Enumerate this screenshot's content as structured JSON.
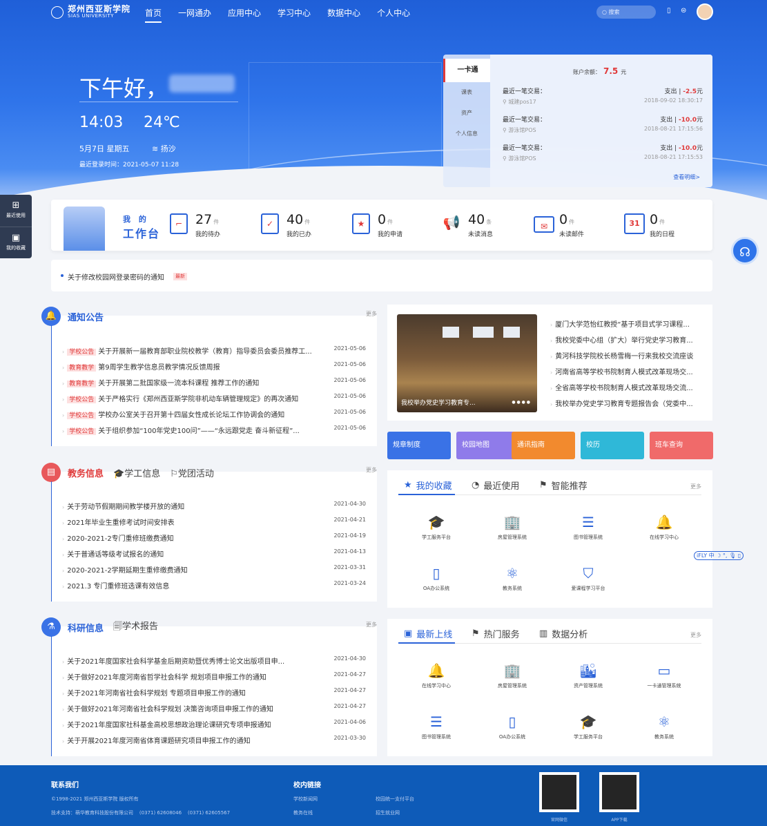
{
  "nav": {
    "logo_cn": "郑州西亚斯学院",
    "logo_en": "SIAS UNIVERSITY",
    "menu": [
      "首页",
      "一网通办",
      "应用中心",
      "学习中心",
      "数据中心",
      "个人中心"
    ],
    "search_placeholder": "搜索"
  },
  "hero": {
    "greeting": "下午好，",
    "time": "14:03",
    "temperature": "24℃",
    "date": "5月7日 星期五",
    "weather": "扬沙",
    "last_login": "最近登录时间：2021-05-07 11:28"
  },
  "card": {
    "tabs": [
      "一卡通",
      "课表",
      "资产",
      "个人信息"
    ],
    "balance_label": "账户余额：",
    "balance": "7.5",
    "balance_unit": "元",
    "transactions": [
      {
        "label": "最近一笔交易：",
        "place": "城建pos17",
        "type": "支出 | ",
        "amount": "-2.5",
        "unit": "元",
        "time": "2018-09-02 18:30:17"
      },
      {
        "label": "最近一笔交易：",
        "place": "游泳馆POS",
        "type": "支出 | ",
        "amount": "-10.0",
        "unit": "元",
        "time": "2018-08-21 17:15:56"
      },
      {
        "label": "最近一笔交易：",
        "place": "游泳馆POS",
        "type": "支出 | ",
        "amount": "-10.0",
        "unit": "元",
        "time": "2018-08-21 17:15:53"
      }
    ],
    "more": "查看明细>"
  },
  "side": {
    "recent": "最近使用",
    "fav": "我的收藏"
  },
  "workbench": {
    "title1": "我 的",
    "title2": "工作台",
    "stats": [
      {
        "num": "27",
        "unit": "件",
        "label": "我的待办"
      },
      {
        "num": "40",
        "unit": "件",
        "label": "我的已办"
      },
      {
        "num": "0",
        "unit": "件",
        "label": "我的申请"
      },
      {
        "num": "40",
        "unit": "条",
        "label": "未读消息"
      },
      {
        "num": "0",
        "unit": "件",
        "label": "未读邮件"
      },
      {
        "num": "0",
        "unit": "件",
        "label": "我的日程"
      }
    ],
    "calendar_day": "31"
  },
  "notice": {
    "text": "关于修改校园网登录密码的通知",
    "badge": "最新"
  },
  "announcements": {
    "title": "通知公告",
    "more": "更多",
    "items": [
      {
        "tag": "学校公告",
        "title": "关于开展新一届教育部职业院校教学（教育）指导委员会委员推荐工...",
        "date": "2021-05-06"
      },
      {
        "tag": "教育教学",
        "title": "第9周学生教学信息员教学情况反馈周报",
        "date": "2021-05-06"
      },
      {
        "tag": "教育教学",
        "title": "关于开展第二批国家级一流本科课程 推荐工作的通知",
        "date": "2021-05-06"
      },
      {
        "tag": "学校公告",
        "title": "关于严格实行《郑州西亚斯学院非机动车辆管理规定》的再次通知",
        "date": "2021-05-06"
      },
      {
        "tag": "学校公告",
        "title": "学校办公室关于召开第十四届女性成长论坛工作协调会的通知",
        "date": "2021-05-06"
      },
      {
        "tag": "学校公告",
        "title": "关于组织参加“100年党史100问”——“永远跟党走 奋斗新征程”...",
        "date": "2021-05-06"
      }
    ]
  },
  "academic": {
    "title": "教务信息",
    "tab2": "学工信息",
    "tab3": "党团活动",
    "more": "更多",
    "items": [
      {
        "title": "关于劳动节假期期间教学楼开放的通知",
        "date": "2021-04-30"
      },
      {
        "title": "2021年毕业生重修考试时间安排表",
        "date": "2021-04-21"
      },
      {
        "title": "2020-2021-2专门重修班缴费通知",
        "date": "2021-04-19"
      },
      {
        "title": "关于普通话等级考试报名的通知",
        "date": "2021-04-13"
      },
      {
        "title": "2020-2021-2学期延期生重修缴费通知",
        "date": "2021-03-31"
      },
      {
        "title": "2021.3 专门重修班选课有效信息",
        "date": "2021-03-24"
      }
    ]
  },
  "research": {
    "title": "科研信息",
    "tab2": "学术报告",
    "more": "更多",
    "items": [
      {
        "title": "关于2021年度国家社会科学基金后期资助暨优秀博士论文出版项目申...",
        "date": "2021-04-30"
      },
      {
        "title": "关于做好2021年度河南省哲学社会科学 规划项目申报工作的通知",
        "date": "2021-04-27"
      },
      {
        "title": "关于2021年河南省社会科学规划 专题项目申报工作的通知",
        "date": "2021-04-27"
      },
      {
        "title": "关于做好2021年河南省社会科学规划 决策咨询项目申报工作的通知",
        "date": "2021-04-27"
      },
      {
        "title": "关于2021年度国家社科基金高校思想政治理论课研究专项申报通知",
        "date": "2021-04-06"
      },
      {
        "title": "关于开展2021年度河南省体育课题研究项目申报工作的通知",
        "date": "2021-03-30"
      }
    ]
  },
  "news": {
    "caption": "我校举办党史学习教育专...",
    "items": [
      "厦门大学范怡红教授“基于项目式学习课程...",
      "我校党委中心组（扩大）举行党史学习教育...",
      "黄河科技学院校长杨雪梅一行来我校交流座谈",
      "河南省高等学校书院制育人模式改革现场交...",
      "全省高等学校书院制育人模式改革现场交流...",
      "我校举办党史学习教育专题报告会（党委中..."
    ]
  },
  "quick": [
    {
      "label": "规章制度",
      "color": "#3a72e6"
    },
    {
      "label": "校园地图",
      "color": "#8f7bea"
    },
    {
      "label": "通讯指南",
      "color": "#f28a2e"
    },
    {
      "label": "校历",
      "color": "#2fb8d8"
    },
    {
      "label": "班车查询",
      "color": "#f06a6a"
    }
  ],
  "favorites": {
    "tabs": [
      "我的收藏",
      "最近使用",
      "智能推荐"
    ],
    "more": "更多",
    "apps": [
      "学工服务平台",
      "房屋管理系统",
      "图书管理系统",
      "在线学习中心",
      "OA办公系统",
      "教务系统",
      "爱课程学习平台"
    ]
  },
  "latest": {
    "tabs": [
      "最新上线",
      "热门服务",
      "数据分析"
    ],
    "more": "更多",
    "apps": [
      "在线学习中心",
      "房屋管理系统",
      "资产管理系统",
      "一卡通管理系统",
      "图书管理系统",
      "OA办公系统",
      "学工服务平台",
      "教务系统"
    ]
  },
  "iflytek": "iFLY 中 ☽ °, 🎙 ▯",
  "footer": {
    "contact_title": "联系我们",
    "copyright": "©1998-2021 郑州西亚斯学院 版权所有",
    "support": "技术支持：萌华教育科技股份有限公司    (0371) 62608046    (0371) 62605567",
    "links_title": "校内链接",
    "links": [
      "学校新闻网",
      "校园统一支付平台",
      "教务在线",
      "招生就业网"
    ],
    "qr1": "官网微信",
    "qr2": "APP下载"
  }
}
